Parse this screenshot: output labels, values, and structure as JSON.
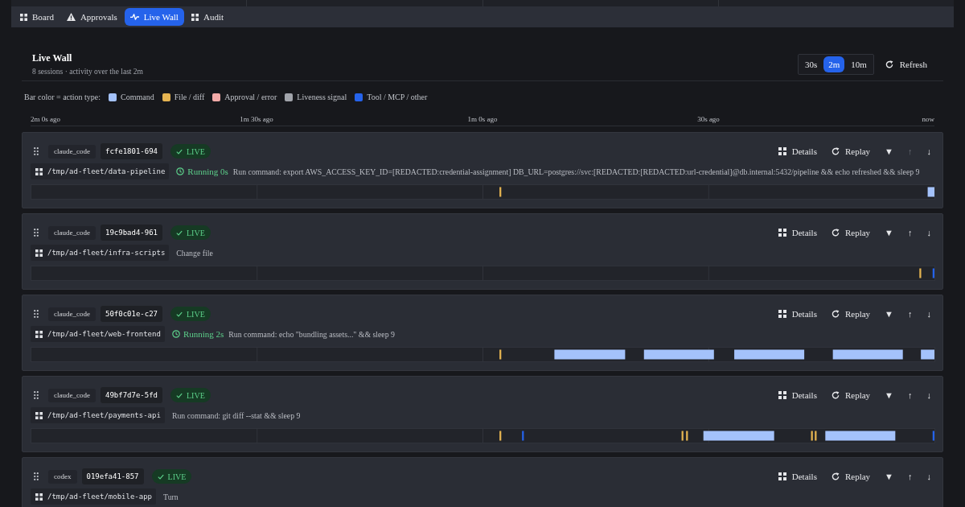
{
  "nav": {
    "tabs": [
      {
        "label": "Board",
        "kind": "board",
        "selected": false
      },
      {
        "label": "Approvals",
        "kind": "approvals",
        "selected": false
      },
      {
        "label": "Live Wall",
        "kind": "live",
        "selected": true
      },
      {
        "label": "Audit",
        "kind": "audit",
        "selected": false
      }
    ]
  },
  "header": {
    "title": "Live Wall",
    "subtitle": "8 sessions · activity over the last 2m",
    "ranges": [
      {
        "label": "30s",
        "selected": false
      },
      {
        "label": "2m",
        "selected": true
      },
      {
        "label": "10m",
        "selected": false
      }
    ],
    "refresh": "Refresh"
  },
  "legend": {
    "label": "Bar color = action type:",
    "items": [
      {
        "label": "Command",
        "color": "#a4c2fb"
      },
      {
        "label": "File / diff",
        "color": "#e5b451"
      },
      {
        "label": "Approval / error",
        "color": "#f3aaa8"
      },
      {
        "label": "Liveness signal",
        "color": "#a1a4ab"
      },
      {
        "label": "Tool / MCP / other",
        "color": "#2563eb"
      }
    ]
  },
  "time_axis": {
    "labels": [
      "2m 0s ago",
      "1m 30s ago",
      "1m 0s ago",
      "30s ago",
      "now"
    ]
  },
  "sessions": [
    {
      "agent": "claude_code",
      "id": "fcfe1801-694",
      "status": {
        "kind": "live",
        "label": "LIVE"
      },
      "path": "/tmp/ad-fleet/data-pipeline",
      "running": "Running 0s",
      "activity": "Run command: export AWS_ACCESS_KEY_ID=[REDACTED:credential-assignment] DB_URL=postgres://svc:[REDACTED:[REDACTED:url-credential]@db.internal:5432/pipeline && echo refreshed && sleep 9",
      "actions": [
        {
          "kind": "details",
          "label": "Details",
          "disabled": false
        },
        {
          "kind": "replay",
          "label": "Replay",
          "disabled": false
        },
        {
          "kind": "collapse",
          "label": "▼",
          "disabled": false
        },
        {
          "kind": "up",
          "label": "↑",
          "disabled": true
        },
        {
          "kind": "down",
          "label": "↓",
          "disabled": false
        }
      ]
    },
    {
      "agent": "claude_code",
      "id": "19c9bad4-961",
      "status": {
        "kind": "live",
        "label": "LIVE"
      },
      "path": "/tmp/ad-fleet/infra-scripts",
      "activity": "Change file",
      "actions": [
        {
          "kind": "details",
          "label": "Details",
          "disabled": false
        },
        {
          "kind": "replay",
          "label": "Replay",
          "disabled": false
        },
        {
          "kind": "collapse",
          "label": "▼",
          "disabled": false
        },
        {
          "kind": "up",
          "label": "↑",
          "disabled": false
        },
        {
          "kind": "down",
          "label": "↓",
          "disabled": false
        }
      ]
    },
    {
      "agent": "claude_code",
      "id": "50f0c01e-c27",
      "status": {
        "kind": "live",
        "label": "LIVE"
      },
      "path": "/tmp/ad-fleet/web-frontend",
      "running": "Running 2s",
      "activity": "Run command: echo \"bundling assets...\" && sleep 9",
      "actions": [
        {
          "kind": "details",
          "label": "Details",
          "disabled": false
        },
        {
          "kind": "replay",
          "label": "Replay",
          "disabled": false
        },
        {
          "kind": "collapse",
          "label": "▼",
          "disabled": false
        },
        {
          "kind": "up",
          "label": "↑",
          "disabled": false
        },
        {
          "kind": "down",
          "label": "↓",
          "disabled": false
        }
      ]
    },
    {
      "agent": "claude_code",
      "id": "49bf7d7e-5fd",
      "status": {
        "kind": "live",
        "label": "LIVE"
      },
      "path": "/tmp/ad-fleet/payments-api",
      "activity": "Run command: git diff --stat && sleep 9",
      "actions": [
        {
          "kind": "details",
          "label": "Details",
          "disabled": false
        },
        {
          "kind": "replay",
          "label": "Replay",
          "disabled": false
        },
        {
          "kind": "collapse",
          "label": "▼",
          "disabled": false
        },
        {
          "kind": "up",
          "label": "↑",
          "disabled": false
        },
        {
          "kind": "down",
          "label": "↓",
          "disabled": false
        }
      ]
    },
    {
      "agent": "codex",
      "id": "019efa41-857",
      "status": {
        "kind": "live",
        "label": "LIVE"
      },
      "path": "/tmp/ad-fleet/mobile-app",
      "activity": "Turn",
      "actions": [
        {
          "kind": "details",
          "label": "Details",
          "disabled": false
        },
        {
          "kind": "replay",
          "label": "Replay",
          "disabled": false
        },
        {
          "kind": "collapse",
          "label": "▼",
          "disabled": false
        },
        {
          "kind": "up",
          "label": "↑",
          "disabled": false
        },
        {
          "kind": "down",
          "label": "↓",
          "disabled": false
        }
      ]
    }
  ]
}
